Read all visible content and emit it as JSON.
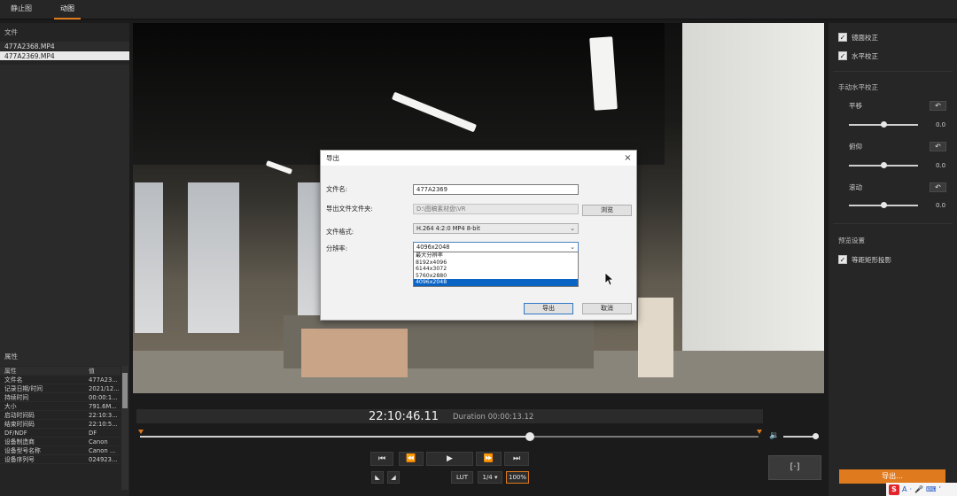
{
  "topbar": {
    "tabs": [
      {
        "label": "静止图"
      },
      {
        "label": "动图"
      }
    ]
  },
  "left": {
    "files_header": "文件",
    "files": [
      {
        "name": "477A2368.MP4"
      },
      {
        "name": "477A2369.MP4"
      }
    ],
    "properties_header": "属性",
    "prop_columns": {
      "key": "属性",
      "value": "值"
    },
    "properties": [
      {
        "k": "文件名",
        "v": "477A23..."
      },
      {
        "k": "记录日期/时间",
        "v": "2021/12..."
      },
      {
        "k": "持续时间",
        "v": "00:00:1..."
      },
      {
        "k": "大小",
        "v": "791.6M..."
      },
      {
        "k": "启动时间码",
        "v": "22:10:3..."
      },
      {
        "k": "结束时间码",
        "v": "22:10:5..."
      },
      {
        "k": "DF/NDF",
        "v": "DF"
      },
      {
        "k": "设备制造商",
        "v": "Canon"
      },
      {
        "k": "设备型号名称",
        "v": "Canon ..."
      },
      {
        "k": "设备序列号",
        "v": "024923..."
      }
    ]
  },
  "dialog": {
    "title": "导出",
    "close": "×",
    "filename_label": "文件名:",
    "filename_value": "477A2369",
    "folder_label": "导出文件文件夹:",
    "folder_value": "D:\\图稿素材盘\\VR",
    "browse_label": "浏览",
    "format_label": "文件格式:",
    "format_value": "H.264 4:2:0 MP4 8-bit",
    "resolution_label": "分辨率:",
    "resolution_value": "4096x2048",
    "resolution_options": [
      "最大分辨率",
      "8192x4096",
      "6144x3072",
      "5760x2880",
      "4096x2048"
    ],
    "export_label": "导出",
    "cancel_label": "取消"
  },
  "timeline": {
    "timecode": "22:10:46.11",
    "duration": "Duration 00:00:13.12",
    "playhead_fraction": 0.63,
    "volume_fraction": 0.9,
    "lut_label": "LUT",
    "speed_label": "1/4 ▾",
    "zoom_label": "100%"
  },
  "right": {
    "lens_correction": "镜面校正",
    "level_correction": "水平校正",
    "manual_header": "手动水平校正",
    "sliders": [
      {
        "label": "平移",
        "value": "0.0",
        "fraction": 0.5
      },
      {
        "label": "俯仰",
        "value": "0.0",
        "fraction": 0.5
      },
      {
        "label": "滚动",
        "value": "0.0",
        "fraction": 0.5
      }
    ],
    "preview_header": "预览设置",
    "preview_option": "等距矩形投影",
    "export_button": "导出..."
  },
  "ime": {
    "s": "S",
    "a": "A",
    "mid": "·",
    "lang": "ʼ"
  },
  "colors": {
    "accent": "#e07a1e",
    "panel": "#262626",
    "selection": "#0a64c4"
  }
}
